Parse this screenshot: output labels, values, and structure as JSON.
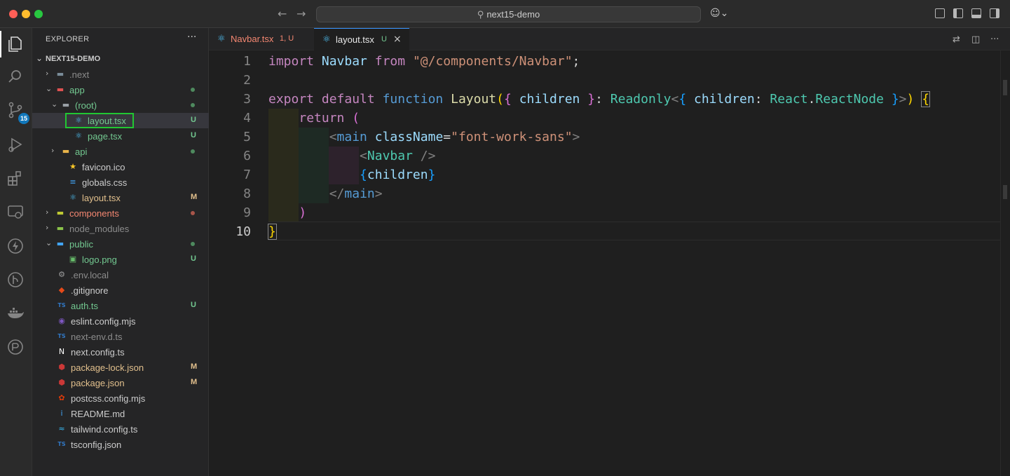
{
  "window": {
    "search_text": "next15-demo"
  },
  "activity_bar": {
    "source_control_badge": "15",
    "icons": [
      "explorer-icon",
      "search-icon",
      "source-control-icon",
      "run-debug-icon",
      "extensions-icon",
      "remote-explorer-icon",
      "thunder-client-icon",
      "gitlens-icon",
      "docker-icon",
      "accounts-icon"
    ]
  },
  "sidebar": {
    "title": "EXPLORER",
    "more": "···",
    "project": "NEXT15-DEMO",
    "tree": [
      {
        "name": ".next",
        "indent": 0,
        "type": "folder",
        "expanded": false,
        "status": "",
        "color": "#8c8c8c",
        "icon_color": "#7a8c99"
      },
      {
        "name": "app",
        "indent": 0,
        "type": "folder",
        "expanded": true,
        "status": "dot",
        "color": "#73c991",
        "icon_color": "#e05252"
      },
      {
        "name": "(root)",
        "indent": 1,
        "type": "folder",
        "expanded": true,
        "status": "dot",
        "color": "#73c991",
        "icon_color": "#9aa0a6"
      },
      {
        "name": "layout.tsx",
        "indent": 2,
        "type": "react",
        "status": "U",
        "color": "#73c991",
        "selected": true
      },
      {
        "name": "page.tsx",
        "indent": 2,
        "type": "react",
        "status": "U",
        "color": "#73c991"
      },
      {
        "name": "api",
        "indent": 1,
        "type": "folder",
        "expanded": false,
        "status": "dot",
        "color": "#73c991",
        "icon_color": "#e8b34a"
      },
      {
        "name": "favicon.ico",
        "indent": 1,
        "type": "star",
        "status": "",
        "color": "#cccccc"
      },
      {
        "name": "globals.css",
        "indent": 1,
        "type": "css",
        "status": "",
        "color": "#cccccc"
      },
      {
        "name": "layout.tsx",
        "indent": 1,
        "type": "react",
        "status": "M",
        "color": "#e2c08d"
      },
      {
        "name": "components",
        "indent": 0,
        "type": "folder",
        "expanded": false,
        "status": "dot-red",
        "color": "#f48771",
        "icon_color": "#c0ca33"
      },
      {
        "name": "node_modules",
        "indent": 0,
        "type": "folder",
        "expanded": false,
        "status": "",
        "color": "#8c8c8c",
        "icon_color": "#8bc34a"
      },
      {
        "name": "public",
        "indent": 0,
        "type": "folder",
        "expanded": true,
        "status": "dot",
        "color": "#73c991",
        "icon_color": "#42a5f5"
      },
      {
        "name": "logo.png",
        "indent": 1,
        "type": "image",
        "status": "U",
        "color": "#73c991"
      },
      {
        "name": ".env.local",
        "indent": 0,
        "type": "env",
        "status": "",
        "color": "#8c8c8c"
      },
      {
        "name": ".gitignore",
        "indent": 0,
        "type": "git",
        "status": "",
        "color": "#cccccc"
      },
      {
        "name": "auth.ts",
        "indent": 0,
        "type": "ts",
        "status": "U",
        "color": "#73c991"
      },
      {
        "name": "eslint.config.mjs",
        "indent": 0,
        "type": "eslint",
        "status": "",
        "color": "#cccccc"
      },
      {
        "name": "next-env.d.ts",
        "indent": 0,
        "type": "dts",
        "status": "",
        "color": "#8c8c8c"
      },
      {
        "name": "next.config.ts",
        "indent": 0,
        "type": "next",
        "status": "",
        "color": "#cccccc"
      },
      {
        "name": "package-lock.json",
        "indent": 0,
        "type": "npm",
        "status": "M",
        "color": "#e2c08d"
      },
      {
        "name": "package.json",
        "indent": 0,
        "type": "npm",
        "status": "M",
        "color": "#e2c08d"
      },
      {
        "name": "postcss.config.mjs",
        "indent": 0,
        "type": "postcss",
        "status": "",
        "color": "#cccccc"
      },
      {
        "name": "README.md",
        "indent": 0,
        "type": "info",
        "status": "",
        "color": "#cccccc"
      },
      {
        "name": "tailwind.config.ts",
        "indent": 0,
        "type": "tailwind",
        "status": "",
        "color": "#cccccc"
      },
      {
        "name": "tsconfig.json",
        "indent": 0,
        "type": "tsconfig",
        "status": "",
        "color": "#cccccc"
      }
    ]
  },
  "tabs": [
    {
      "label": "Navbar.tsx",
      "modifier": "1, U",
      "active": false,
      "color": "#f48771"
    },
    {
      "label": "layout.tsx",
      "modifier": "U",
      "active": true,
      "color": "#73c991",
      "close": "×"
    }
  ],
  "editor": {
    "current_line": 10,
    "lines": [
      {
        "n": "1",
        "tokens": [
          [
            "import",
            "kw"
          ],
          [
            " ",
            ""
          ],
          [
            "Navbar",
            "var"
          ],
          [
            " ",
            ""
          ],
          [
            "from",
            "kw"
          ],
          [
            " ",
            ""
          ],
          [
            "\"@/components/Navbar\"",
            "str"
          ],
          [
            ";",
            ""
          ]
        ]
      },
      {
        "n": "2",
        "tokens": []
      },
      {
        "n": "3",
        "tokens": [
          [
            "export",
            "kw"
          ],
          [
            " ",
            ""
          ],
          [
            "default",
            "kw"
          ],
          [
            " ",
            ""
          ],
          [
            "function",
            "kw2"
          ],
          [
            " ",
            ""
          ],
          [
            "Layout",
            "fn"
          ],
          [
            "(",
            "br1"
          ],
          [
            "{",
            "br2"
          ],
          [
            " ",
            ""
          ],
          [
            "children",
            "var"
          ],
          [
            " ",
            ""
          ],
          [
            "}",
            "br2"
          ],
          [
            ": ",
            ""
          ],
          [
            "Readonly",
            "ty"
          ],
          [
            "<",
            "punc"
          ],
          [
            "{",
            "br3"
          ],
          [
            " ",
            ""
          ],
          [
            "children",
            "var"
          ],
          [
            ": ",
            ""
          ],
          [
            "React",
            "ty"
          ],
          [
            ".",
            ""
          ],
          [
            "ReactNode",
            "ty"
          ],
          [
            " ",
            ""
          ],
          [
            "}",
            "br3"
          ],
          [
            ">",
            "punc"
          ],
          [
            ")",
            "br1"
          ],
          [
            " ",
            ""
          ],
          [
            "{",
            "br1box"
          ]
        ]
      },
      {
        "n": "4",
        "tokens": [
          [
            "    ",
            ""
          ],
          [
            "return",
            "kw"
          ],
          [
            " ",
            ""
          ],
          [
            "(",
            "br2"
          ]
        ]
      },
      {
        "n": "5",
        "tokens": [
          [
            "        ",
            ""
          ],
          [
            "<",
            "punc"
          ],
          [
            "main",
            "kw2"
          ],
          [
            " ",
            ""
          ],
          [
            "className",
            "attr"
          ],
          [
            "=",
            ""
          ],
          [
            "\"font-work-sans\"",
            "str"
          ],
          [
            ">",
            "punc"
          ]
        ]
      },
      {
        "n": "6",
        "tokens": [
          [
            "            ",
            ""
          ],
          [
            "<",
            "punc"
          ],
          [
            "Navbar",
            "tag"
          ],
          [
            " />",
            "punc"
          ]
        ]
      },
      {
        "n": "7",
        "tokens": [
          [
            "            ",
            ""
          ],
          [
            "{",
            "br3"
          ],
          [
            "children",
            "var"
          ],
          [
            "}",
            "br3"
          ]
        ]
      },
      {
        "n": "8",
        "tokens": [
          [
            "        ",
            ""
          ],
          [
            "</",
            "punc"
          ],
          [
            "main",
            "kw2"
          ],
          [
            ">",
            "punc"
          ]
        ]
      },
      {
        "n": "9",
        "tokens": [
          [
            "    ",
            ""
          ],
          [
            ")",
            "br2"
          ]
        ]
      },
      {
        "n": "10",
        "tokens": [
          [
            "}",
            "br1box"
          ]
        ]
      }
    ]
  }
}
